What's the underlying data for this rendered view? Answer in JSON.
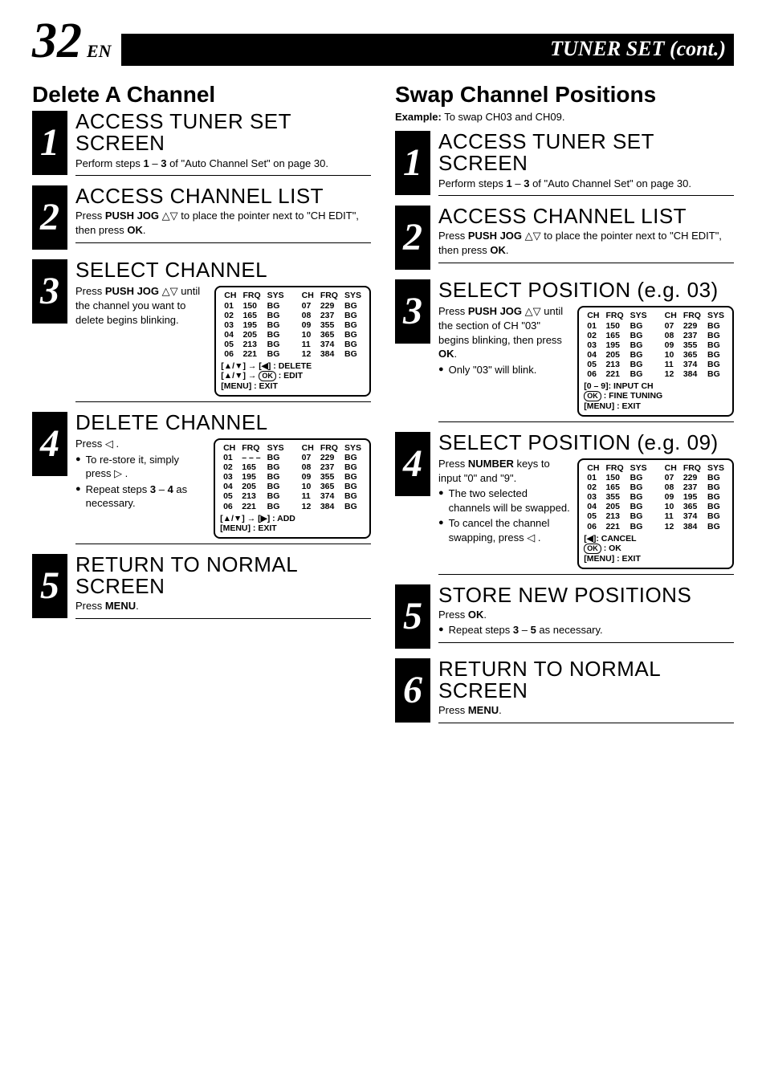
{
  "header": {
    "page_number": "32",
    "page_lang": "EN",
    "title": "TUNER SET (cont.)"
  },
  "left": {
    "section_title": "Delete A Channel",
    "steps": [
      {
        "num": "1",
        "title": "ACCESS TUNER SET SCREEN",
        "text": "Perform steps 1 – 3 of \"Auto Channel Set\" on page 30."
      },
      {
        "num": "2",
        "title": "ACCESS CHANNEL LIST",
        "text": "Press PUSH JOG △▽ to place the pointer next to \"CH EDIT\", then press OK."
      },
      {
        "num": "3",
        "title": "SELECT CHANNEL",
        "text": "Press PUSH JOG △▽ until the channel you want to delete begins blinking.",
        "osd": {
          "headers": [
            "CH",
            "FRQ",
            "SYS"
          ],
          "left_rows": [
            [
              "01",
              "150",
              "BG"
            ],
            [
              "02",
              "165",
              "BG"
            ],
            [
              "03",
              "195",
              "BG"
            ],
            [
              "04",
              "205",
              "BG"
            ],
            [
              "05",
              "213",
              "BG"
            ],
            [
              "06",
              "221",
              "BG"
            ]
          ],
          "right_rows": [
            [
              "07",
              "229",
              "BG"
            ],
            [
              "08",
              "237",
              "BG"
            ],
            [
              "09",
              "355",
              "BG"
            ],
            [
              "10",
              "365",
              "BG"
            ],
            [
              "11",
              "374",
              "BG"
            ],
            [
              "12",
              "384",
              "BG"
            ]
          ],
          "footer": [
            "[▲/▼] → [◀] : DELETE",
            "[▲/▼] → OK : EDIT",
            "[MENU] : EXIT"
          ]
        }
      },
      {
        "num": "4",
        "title": "DELETE CHANNEL",
        "text": "Press ◁ .",
        "bullets": [
          "To re-store it, simply press ▷ .",
          "Repeat steps 3 – 4 as necessary."
        ],
        "osd": {
          "headers": [
            "CH",
            "FRQ",
            "SYS"
          ],
          "left_rows": [
            [
              "01",
              "– – –",
              "BG"
            ],
            [
              "02",
              "165",
              "BG"
            ],
            [
              "03",
              "195",
              "BG"
            ],
            [
              "04",
              "205",
              "BG"
            ],
            [
              "05",
              "213",
              "BG"
            ],
            [
              "06",
              "221",
              "BG"
            ]
          ],
          "right_rows": [
            [
              "07",
              "229",
              "BG"
            ],
            [
              "08",
              "237",
              "BG"
            ],
            [
              "09",
              "355",
              "BG"
            ],
            [
              "10",
              "365",
              "BG"
            ],
            [
              "11",
              "374",
              "BG"
            ],
            [
              "12",
              "384",
              "BG"
            ]
          ],
          "footer": [
            "[▲/▼] → [▶] : ADD",
            "[MENU] : EXIT"
          ]
        }
      },
      {
        "num": "5",
        "title": "RETURN TO NORMAL SCREEN",
        "text": "Press MENU."
      }
    ]
  },
  "right": {
    "section_title": "Swap Channel Positions",
    "example": "Example: To swap CH03 and CH09.",
    "steps": [
      {
        "num": "1",
        "title": "ACCESS TUNER SET SCREEN",
        "text": "Perform steps 1 – 3 of \"Auto Channel Set\" on page 30."
      },
      {
        "num": "2",
        "title": "ACCESS CHANNEL LIST",
        "text": "Press PUSH JOG △▽ to place the pointer next to \"CH EDIT\", then press OK."
      },
      {
        "num": "3",
        "title": "SELECT POSITION (e.g. 03)",
        "text": "Press PUSH JOG △▽ until the section of CH \"03\" begins blinking, then press OK.",
        "bullets": [
          "Only \"03\" will blink."
        ],
        "osd": {
          "headers": [
            "CH",
            "FRQ",
            "SYS"
          ],
          "left_rows": [
            [
              "01",
              "150",
              "BG"
            ],
            [
              "02",
              "165",
              "BG"
            ],
            [
              "03",
              "195",
              "BG"
            ],
            [
              "04",
              "205",
              "BG"
            ],
            [
              "05",
              "213",
              "BG"
            ],
            [
              "06",
              "221",
              "BG"
            ]
          ],
          "right_rows": [
            [
              "07",
              "229",
              "BG"
            ],
            [
              "08",
              "237",
              "BG"
            ],
            [
              "09",
              "355",
              "BG"
            ],
            [
              "10",
              "365",
              "BG"
            ],
            [
              "11",
              "374",
              "BG"
            ],
            [
              "12",
              "384",
              "BG"
            ]
          ],
          "footer": [
            "[0 – 9]: INPUT CH",
            "OK : FINE TUNING",
            "[MENU] : EXIT"
          ]
        }
      },
      {
        "num": "4",
        "title": "SELECT POSITION (e.g. 09)",
        "text": "Press NUMBER keys to input \"0\" and \"9\".",
        "bullets": [
          "The two selected channels will be swapped.",
          "To cancel the channel swapping, press ◁ ."
        ],
        "osd": {
          "headers": [
            "CH",
            "FRQ",
            "SYS"
          ],
          "left_rows": [
            [
              "01",
              "150",
              "BG"
            ],
            [
              "02",
              "165",
              "BG"
            ],
            [
              "03",
              "355",
              "BG"
            ],
            [
              "04",
              "205",
              "BG"
            ],
            [
              "05",
              "213",
              "BG"
            ],
            [
              "06",
              "221",
              "BG"
            ]
          ],
          "right_rows": [
            [
              "07",
              "229",
              "BG"
            ],
            [
              "08",
              "237",
              "BG"
            ],
            [
              "09",
              "195",
              "BG"
            ],
            [
              "10",
              "365",
              "BG"
            ],
            [
              "11",
              "374",
              "BG"
            ],
            [
              "12",
              "384",
              "BG"
            ]
          ],
          "footer": [
            "[◀]: CANCEL",
            "OK : OK",
            "[MENU] : EXIT"
          ]
        }
      },
      {
        "num": "5",
        "title": "STORE NEW POSITIONS",
        "text": "Press OK.",
        "bullets": [
          "Repeat steps 3 – 5 as necessary."
        ]
      },
      {
        "num": "6",
        "title": "RETURN TO NORMAL SCREEN",
        "text": "Press MENU."
      }
    ]
  }
}
